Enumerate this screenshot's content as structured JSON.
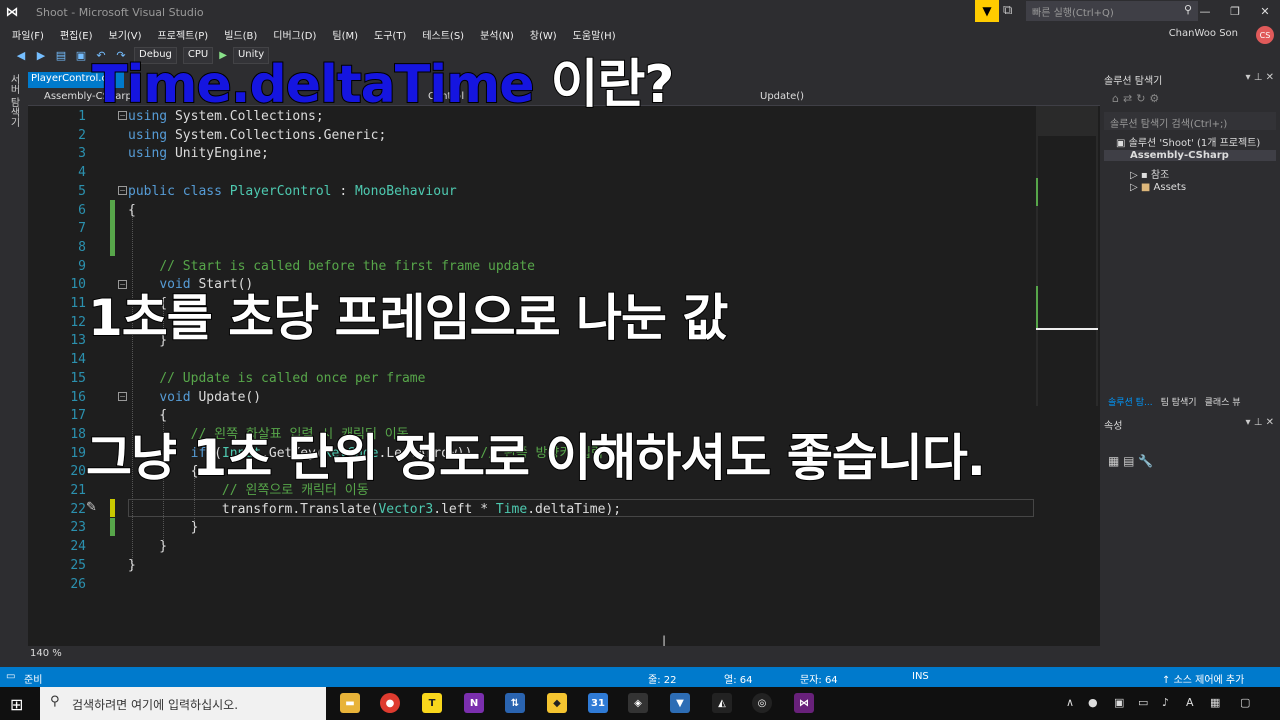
{
  "window": {
    "title": "Shoot - Microsoft Visual Studio",
    "quick_launch_placeholder": "빠른 실행(Ctrl+Q)",
    "user": "ChanWoo Son",
    "user_initials": "CS"
  },
  "menu": [
    "파일(F)",
    "편집(E)",
    "보기(V)",
    "프로젝트(P)",
    "빌드(B)",
    "디버그(D)",
    "팀(M)",
    "도구(T)",
    "테스트(S)",
    "분석(N)",
    "창(W)",
    "도움말(H)"
  ],
  "toolbar": {
    "config": "Debug",
    "platform": "CPU",
    "run_target": "Unity"
  },
  "left_strip_label": "서버 탐색기",
  "editor": {
    "tab_label": "PlayerControl.cs",
    "nav_project": "Assembly-CSharp",
    "nav_class": "Control",
    "nav_member": "Update()",
    "zoom": "140 %",
    "lines": [
      {
        "n": "1",
        "html": "<span class='kw'>using</span> System.Collections;"
      },
      {
        "n": "2",
        "html": "<span class='kw'>using</span> System.Collections.Generic;"
      },
      {
        "n": "3",
        "html": "<span class='kw'>using</span> UnityEngine;"
      },
      {
        "n": "4",
        "html": ""
      },
      {
        "n": "5",
        "html": "<span class='kw'>public class</span> <span class='typ'>PlayerControl</span> : <span class='typ'>MonoBehaviour</span>"
      },
      {
        "n": "6",
        "html": "{"
      },
      {
        "n": "7",
        "html": ""
      },
      {
        "n": "8",
        "html": ""
      },
      {
        "n": "9",
        "html": "    <span class='cm'>// Start is called before the first frame update</span>"
      },
      {
        "n": "10",
        "html": "    <span class='kw'>void</span> Start()"
      },
      {
        "n": "11",
        "html": "    {"
      },
      {
        "n": "12",
        "html": ""
      },
      {
        "n": "13",
        "html": "    }"
      },
      {
        "n": "14",
        "html": ""
      },
      {
        "n": "15",
        "html": "    <span class='cm'>// Update is called once per frame</span>"
      },
      {
        "n": "16",
        "html": "    <span class='kw'>void</span> Update()"
      },
      {
        "n": "17",
        "html": "    {"
      },
      {
        "n": "18",
        "html": "        <span class='cm'>// 왼쪽 화살표 입력 시 캐릭터 이동</span>"
      },
      {
        "n": "19",
        "html": "        <span class='kw'>if</span> (<span class='typ'>Input</span>.GetKey(<span class='typ'>KeyCode</span>.LeftArrow)) <span class='cm'>// 왼쪽 방향키 입력</span>"
      },
      {
        "n": "20",
        "html": "        {"
      },
      {
        "n": "21",
        "html": "            <span class='cm'>// 왼쪽으로 캐릭터 이동</span>"
      },
      {
        "n": "22",
        "html": "            transform.Translate(<span class='typ'>Vector3</span>.left * <span class='typ'>Time</span>.deltaTime);"
      },
      {
        "n": "23",
        "html": "        }"
      },
      {
        "n": "24",
        "html": "    }"
      },
      {
        "n": "25",
        "html": "}"
      },
      {
        "n": "26",
        "html": ""
      }
    ]
  },
  "solution_explorer": {
    "title": "솔루션 탐색기",
    "search_placeholder": "솔루션 탐색기 검색(Ctrl+;)",
    "solution": "솔루션 'Shoot' (1개 프로젝트)",
    "project": "Assembly-CSharp",
    "references": "참조",
    "assets": "Assets",
    "tabs": [
      "솔루션 탐...",
      "팀 탐색기",
      "클래스 뷰"
    ]
  },
  "properties": {
    "title": "속성"
  },
  "statusbar": {
    "ready": "준비",
    "line": "줄: 22",
    "col": "열: 64",
    "ch": "문자: 64",
    "ins": "INS",
    "source_control": "소스 제어에 추가"
  },
  "taskbar": {
    "search_placeholder": "검색하려면 여기에 입력하십시오."
  },
  "captions": {
    "line1_blue": "Time.deltaTime",
    "line1_white": " 이란?",
    "line2": "1초를 초당 프레임으로 나눈 값",
    "line3": "그냥 1초 단위 정도로 이해하셔도 좋습니다."
  }
}
